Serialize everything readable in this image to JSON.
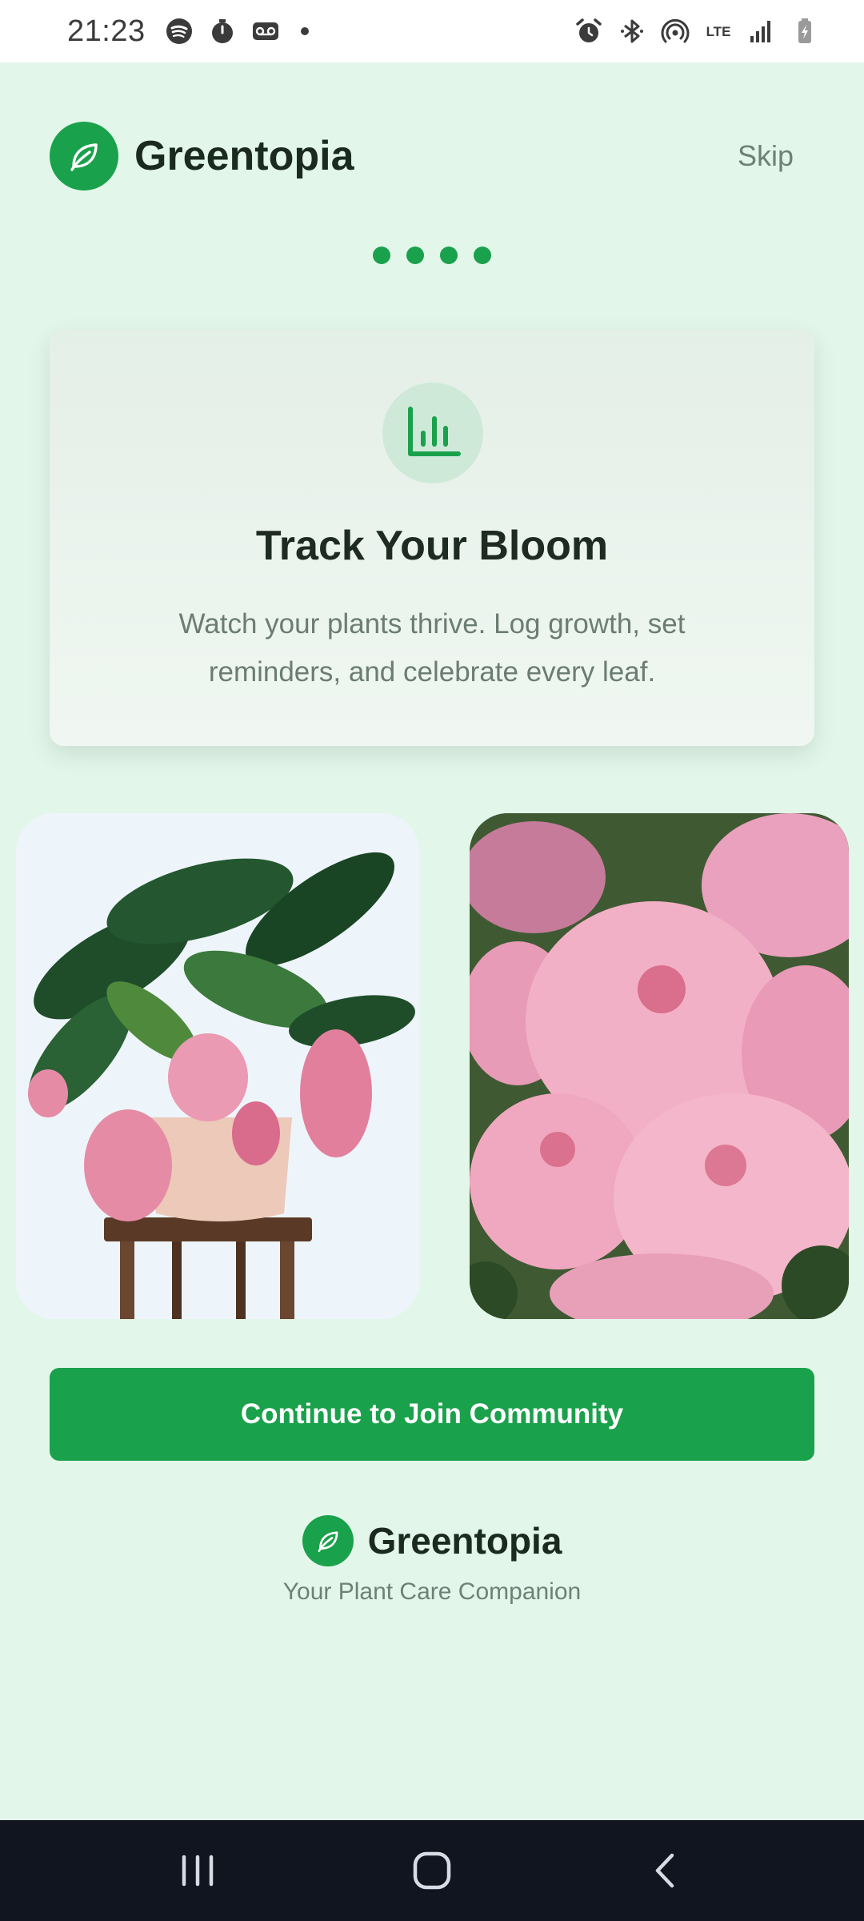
{
  "status_bar": {
    "time": "21:23",
    "left_icons": [
      "spotify-icon",
      "stopwatch-icon",
      "voicemail-icon",
      "notification-dot-icon"
    ],
    "right_icons": [
      "alarm-icon",
      "bluetooth-icon",
      "hotspot-icon",
      "lte-icon",
      "signal-icon",
      "battery-charging-icon"
    ],
    "lte_label": "LTE"
  },
  "header": {
    "app_name": "Greentopia",
    "logo_icon": "leaf-icon",
    "skip_label": "Skip"
  },
  "pager": {
    "total": 4,
    "active_color": "#1aa14b"
  },
  "feature": {
    "icon": "bar-chart-icon",
    "title": "Track Your Bloom",
    "description": "Watch your plants thrive. Log growth, set reminders, and celebrate every leaf."
  },
  "photos": [
    {
      "name": "potted-flowering-plant-photo",
      "subject": "potted flowering plant on stool"
    },
    {
      "name": "pink-azalea-photo",
      "subject": "pink azalea blossoms"
    }
  ],
  "cta": {
    "label": "Continue to Join Community"
  },
  "footer": {
    "app_name": "Greentopia",
    "tagline": "Your Plant Care Companion"
  },
  "nav_bar": {
    "items": [
      "recent-apps-icon",
      "home-icon",
      "back-icon"
    ]
  },
  "colors": {
    "brand_green": "#1aa14b",
    "background": "#e3f6ea",
    "nav_bar": "#111520"
  }
}
